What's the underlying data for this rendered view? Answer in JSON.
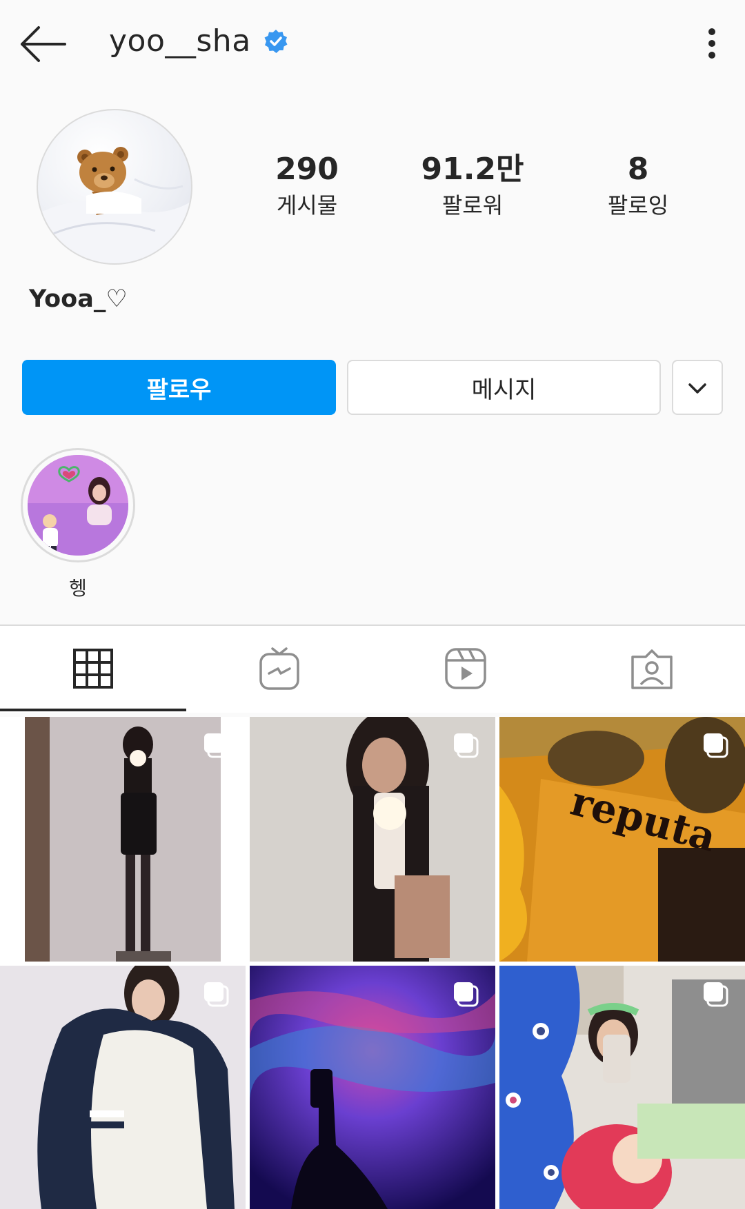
{
  "header": {
    "username": "yoo__sha",
    "verified_icon": "verified-badge-icon",
    "back_icon": "arrow-left-icon",
    "more_icon": "more-vertical-icon"
  },
  "profile": {
    "display_name": "Yooa_♡",
    "stats": [
      {
        "value": "290",
        "label": "게시물"
      },
      {
        "value": "91.2만",
        "label": "팔로워"
      },
      {
        "value": "8",
        "label": "팔로잉"
      }
    ]
  },
  "actions": {
    "follow_label": "팔로우",
    "message_label": "메시지",
    "dropdown_icon": "chevron-down-icon"
  },
  "highlights": [
    {
      "label": "헹"
    }
  ],
  "tabs": [
    {
      "icon": "grid-icon",
      "active": true
    },
    {
      "icon": "igtv-icon",
      "active": false
    },
    {
      "icon": "reels-icon",
      "active": false
    },
    {
      "icon": "tagged-icon",
      "active": false
    }
  ],
  "colors": {
    "accent": "#0095f6",
    "verified": "#3897f0",
    "border": "#dbdbdb",
    "text": "#262626"
  }
}
